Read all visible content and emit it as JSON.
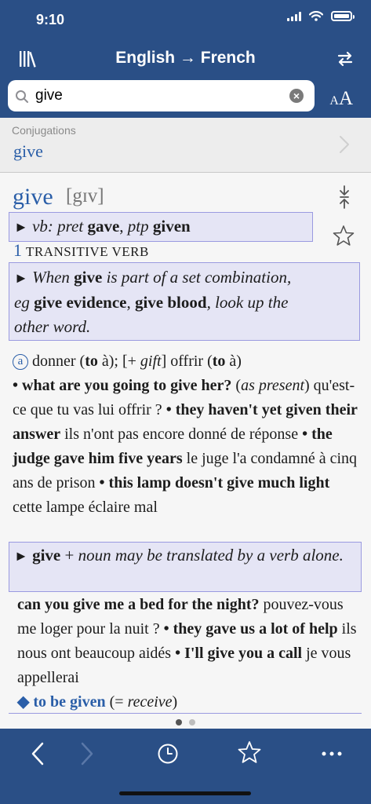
{
  "status": {
    "time": "9:10"
  },
  "nav": {
    "title": "English → French"
  },
  "search": {
    "value": "give"
  },
  "font_size": {
    "small": "A",
    "large": "A"
  },
  "conjugations": {
    "label": "Conjugations",
    "word": "give"
  },
  "entry": {
    "headword": "give",
    "phonetic": "[gɪv]",
    "note1": {
      "tri": "►",
      "abbr": "vb: pret",
      "w1": "gave",
      "sep": ", ",
      "abbr2": "ptp",
      "w2": "given"
    },
    "sense1": {
      "num": "1",
      "label": "TRANSITIVE VERB"
    },
    "note2": {
      "tri": "►",
      "t1": "When",
      "w1": "give",
      "t2": "is part of a set combination,",
      "t3": "eg",
      "w2": "give evidence",
      "sep": ", ",
      "w3": "give blood",
      "t4": ", look up the",
      "t5": "other word."
    },
    "para1": {
      "circ": "a",
      "t1": "donner (",
      "to1": "to",
      "t2": " à); [+ ",
      "gift": "gift",
      "t3": "] offrir (",
      "to2": "to",
      "t4": " à)",
      "e1": "• what are you going to give her?",
      "e1n_open": " (",
      "e1n": "as present",
      "e1n_close": ")",
      "f1": " qu'est-ce que tu vas lui offrir ? ",
      "e2": "• they haven't yet given their answer",
      "f2": " ils n'ont pas encore donné de réponse ",
      "e3": "• the judge gave him five years",
      "f3": " le juge l'a condamné à cinq ans de prison ",
      "e4": "• this lamp doesn't give much light",
      "f4": " cette lampe éclaire mal"
    },
    "note3": {
      "tri": "►",
      "w1": "give",
      "t1": "+",
      "t2": "noun may be translated by a verb alone."
    },
    "para2": {
      "e1": "can you give me a bed for the night?",
      "f1": " pouvez-vous me loger pour la nuit ? ",
      "e2": "• they gave us a lot of help",
      "f2": " ils nous ont beaucoup aidés ",
      "e3": "• I'll give you a call",
      "f3": " je vous appellerai",
      "e4": "◆ to be given",
      "n_open": " (= ",
      "n": "receive",
      "n_close": ")"
    }
  },
  "pager": {
    "pages": 2,
    "active": 1
  },
  "toolbar": {
    "items": [
      "back",
      "forward",
      "history",
      "favorites",
      "more"
    ]
  }
}
